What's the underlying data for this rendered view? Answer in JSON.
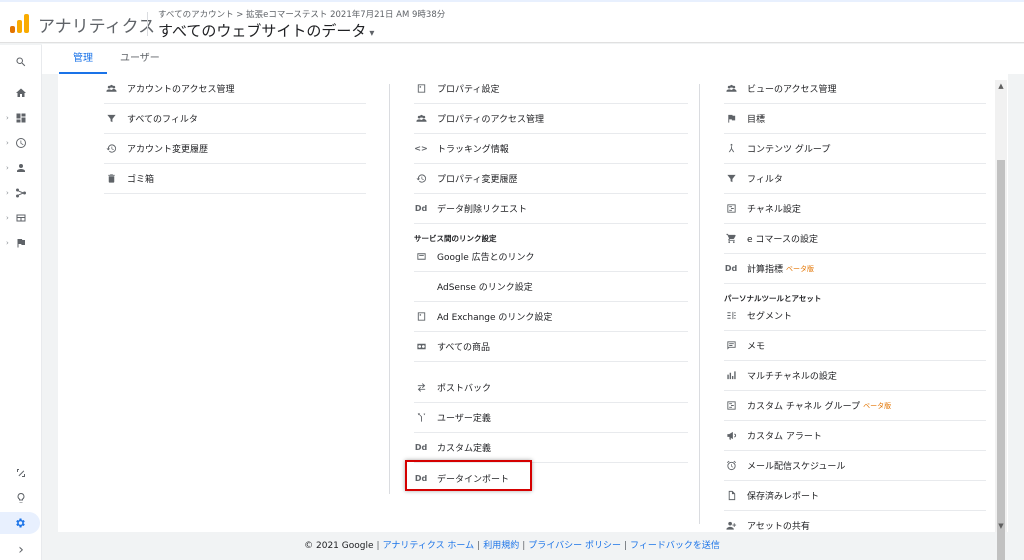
{
  "header": {
    "brand": "アナリティクス",
    "breadcrumb": "すべてのアカウント > 拡張eコマーステスト 2021年7月21日 AM 9時38分",
    "view_title": "すべてのウェブサイトのデータ",
    "caret": "▾"
  },
  "rail": {
    "items": [
      "search-icon",
      "home-icon",
      "dashboard-icon",
      "clock-icon",
      "person-icon",
      "acquisition-icon",
      "behavior-icon",
      "flag-icon",
      "attribution-icon",
      "lightbulb-icon",
      "gear-icon"
    ],
    "expand": "›"
  },
  "tabs": [
    {
      "label": "管理"
    },
    {
      "label": "ユーザー"
    }
  ],
  "account_column": {
    "items": [
      {
        "label": "アカウントのアクセス管理",
        "icon": "people-icon"
      },
      {
        "label": "すべてのフィルタ",
        "icon": "filter-icon"
      },
      {
        "label": "アカウント変更履歴",
        "icon": "history-icon"
      },
      {
        "label": "ゴミ箱",
        "icon": "trash-icon"
      }
    ]
  },
  "property_column": {
    "items": [
      {
        "label": "プロパティ設定",
        "icon": "property-icon"
      },
      {
        "label": "プロパティのアクセス管理",
        "icon": "people-icon"
      },
      {
        "label": "トラッキング情報",
        "icon": "code-icon",
        "glyph": "<>"
      },
      {
        "label": "プロパティ変更履歴",
        "icon": "history-icon"
      },
      {
        "label": "データ削除リクエスト",
        "icon": "dd-icon",
        "glyph": "Dd"
      }
    ],
    "section_label": "サービス間のリンク設定",
    "link_items": [
      {
        "label": "Google 広告とのリンク",
        "icon": "google-ads-icon"
      },
      {
        "label": "AdSense のリンク設定",
        "icon": "adsense-icon"
      },
      {
        "label": "Ad Exchange のリンク設定",
        "icon": "adexchange-icon"
      },
      {
        "label": "すべての商品",
        "icon": "link-icon"
      }
    ],
    "more_items": [
      {
        "label": "ポストバック",
        "icon": "postback-icon"
      },
      {
        "label": "ユーザー定義",
        "icon": "fork-icon"
      },
      {
        "label": "カスタム定義",
        "icon": "dd-icon",
        "glyph": "Dd"
      },
      {
        "label": "データインポート",
        "icon": "dd-icon",
        "glyph": "Dd"
      }
    ]
  },
  "view_column": {
    "items": [
      {
        "label": "ビューのアクセス管理",
        "icon": "people-icon"
      },
      {
        "label": "目標",
        "icon": "flag-icon"
      },
      {
        "label": "コンテンツ グループ",
        "icon": "content-group-icon"
      },
      {
        "label": "フィルタ",
        "icon": "filter-icon"
      },
      {
        "label": "チャネル設定",
        "icon": "channel-icon"
      },
      {
        "label": "e コマースの設定",
        "icon": "cart-icon"
      },
      {
        "label": "計算指標",
        "icon": "dd-icon",
        "glyph": "Dd",
        "badge": "ベータ版"
      }
    ],
    "section_label": "パーソナルツールとアセット",
    "personal_items": [
      {
        "label": "セグメント",
        "icon": "segment-icon"
      },
      {
        "label": "メモ",
        "icon": "memo-icon"
      },
      {
        "label": "マルチチャネルの設定",
        "icon": "bar-chart-icon"
      },
      {
        "label": "カスタム チャネル グループ",
        "icon": "channel-icon",
        "badge": "ベータ版"
      },
      {
        "label": "カスタム アラート",
        "icon": "megaphone-icon"
      },
      {
        "label": "メール配信スケジュール",
        "icon": "alarm-icon"
      },
      {
        "label": "保存済みレポート",
        "icon": "document-icon"
      },
      {
        "label": "アセットの共有",
        "icon": "person-add-icon"
      }
    ]
  },
  "scrollbar": {
    "up": "▲",
    "down": "▼"
  },
  "footer": {
    "copyright": "© 2021 Google",
    "links": [
      "アナリティクス ホーム",
      "利用規約",
      "プライバシー ポリシー",
      "フィードバックを送信"
    ]
  },
  "colors": {
    "accent": "#1a73e8",
    "highlight": "#d50000",
    "logo_orange": "#f9ab00",
    "logo_dark_orange": "#e37400"
  }
}
